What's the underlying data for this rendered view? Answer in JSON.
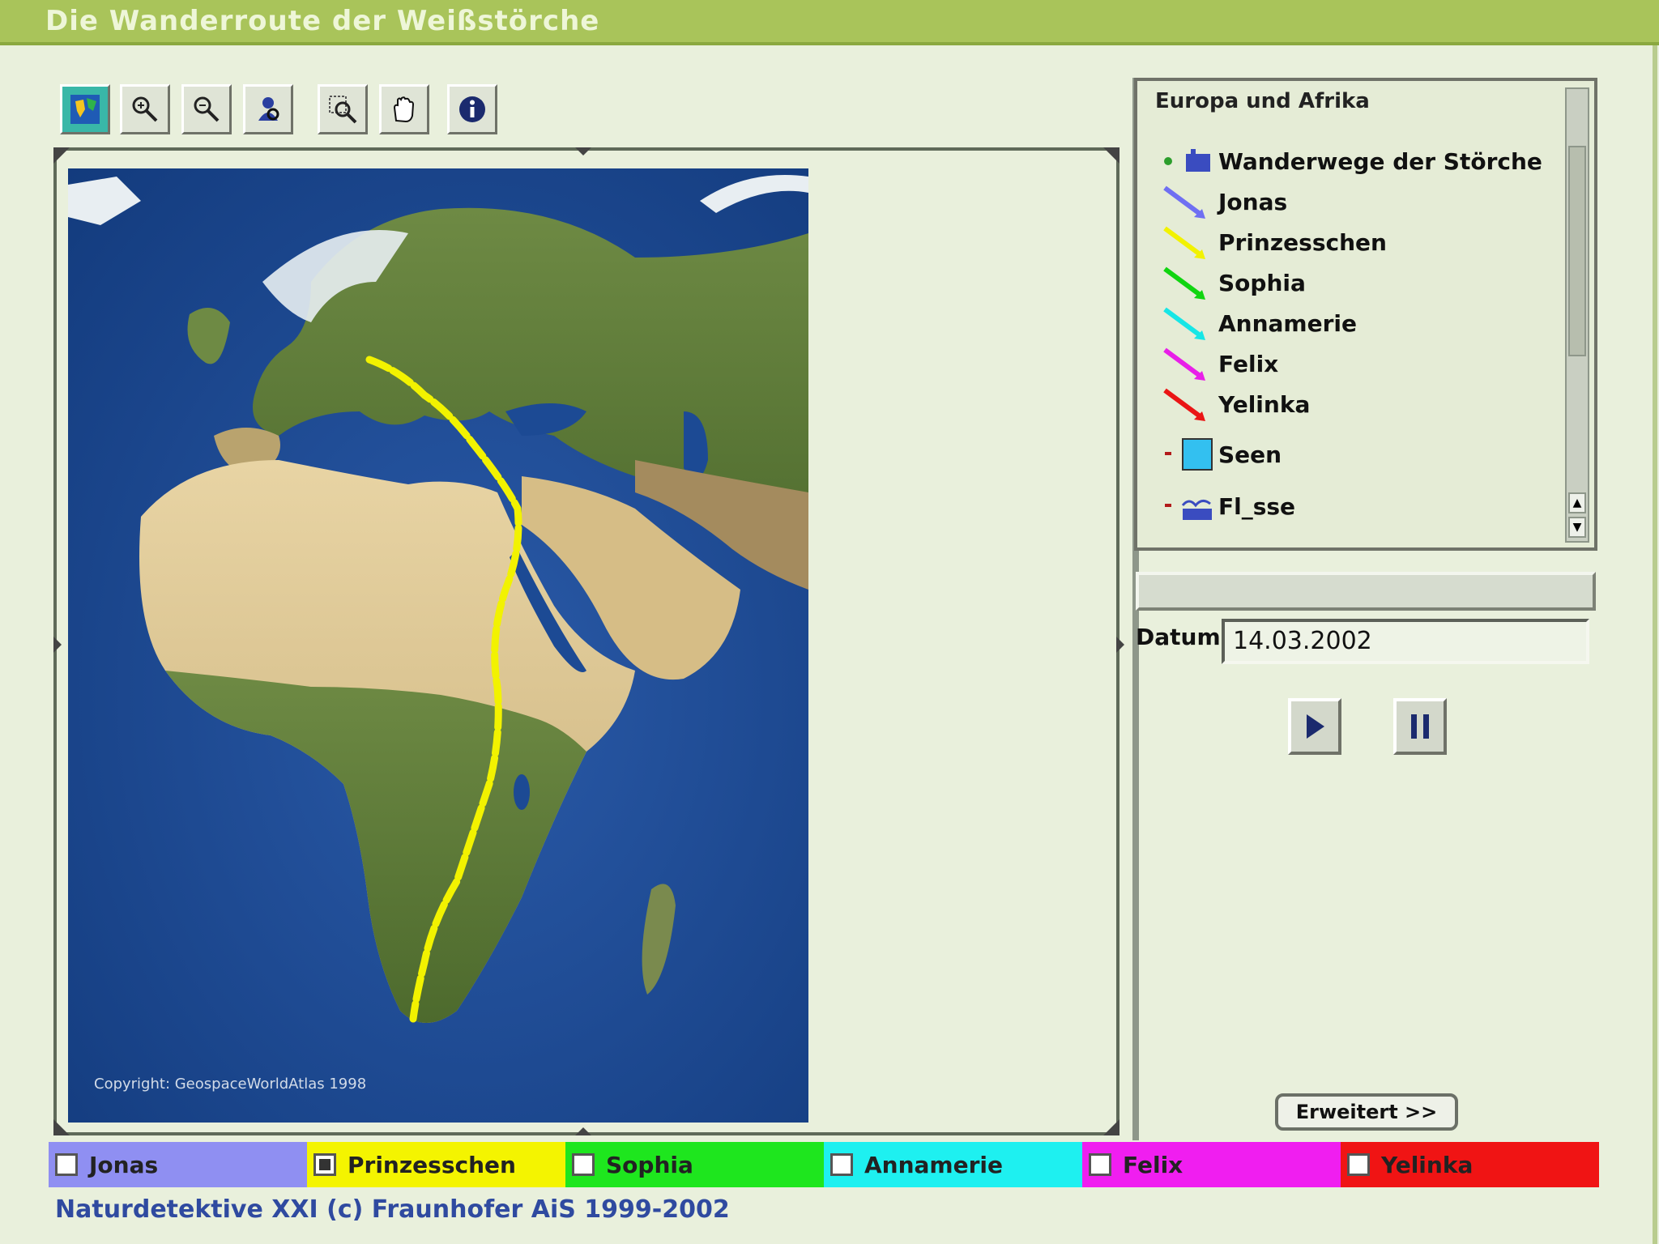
{
  "window": {
    "title": "Die Wanderroute der Weißstörche"
  },
  "toolbar": {
    "buttons": [
      {
        "name": "full-extent",
        "icon": "globe-icon",
        "active": true
      },
      {
        "name": "zoom-in",
        "icon": "zoom-in-icon"
      },
      {
        "name": "zoom-out",
        "icon": "zoom-out-icon"
      },
      {
        "name": "identify-layer",
        "icon": "identify-icon"
      },
      {
        "name": "zoom-box",
        "icon": "magnifier-box-icon"
      },
      {
        "name": "pan",
        "icon": "hand-pan-icon"
      },
      {
        "name": "info",
        "icon": "info-icon"
      }
    ]
  },
  "map": {
    "copyright": "Copyright: GeospaceWorldAtlas 1998",
    "route_color": "#f2f200"
  },
  "legend": {
    "title": "Europa und Afrika",
    "items": [
      {
        "label": "Wanderwege der Störche",
        "symbol": "group",
        "color": "#3a4cc0"
      },
      {
        "label": "Jonas",
        "symbol": "arrow",
        "color": "#6f6ff2"
      },
      {
        "label": "Prinzesschen",
        "symbol": "arrow",
        "color": "#f2f200"
      },
      {
        "label": "Sophia",
        "symbol": "arrow",
        "color": "#10d510"
      },
      {
        "label": "Annamerie",
        "symbol": "arrow",
        "color": "#16e6e6"
      },
      {
        "label": "Felix",
        "symbol": "arrow",
        "color": "#e81fe8"
      },
      {
        "label": "Yelinka",
        "symbol": "arrow",
        "color": "#ea1515"
      },
      {
        "label": "Seen",
        "symbol": "box",
        "color": "#33c0f0"
      },
      {
        "label": "Fl_sse",
        "symbol": "rivers",
        "color": "#3a4cc0"
      }
    ]
  },
  "date": {
    "label": "Datum",
    "value": "14.03.2002"
  },
  "controls": {
    "play_icon": "play-icon",
    "pause_icon": "pause-icon"
  },
  "extend_button": {
    "label": "Erweitert >>"
  },
  "birds": [
    {
      "name": "Jonas",
      "color": "#8f8ff2",
      "checked": false
    },
    {
      "name": "Prinzesschen",
      "color": "#f4f400",
      "checked": true
    },
    {
      "name": "Sophia",
      "color": "#1ee61e",
      "checked": false
    },
    {
      "name": "Annamerie",
      "color": "#1ef0f0",
      "checked": false
    },
    {
      "name": "Felix",
      "color": "#f01ef0",
      "checked": false
    },
    {
      "name": "Yelinka",
      "color": "#f01414",
      "checked": false
    }
  ],
  "footer": {
    "text": "Naturdetektive XXI (c) Fraunhofer AiS 1999-2002"
  }
}
